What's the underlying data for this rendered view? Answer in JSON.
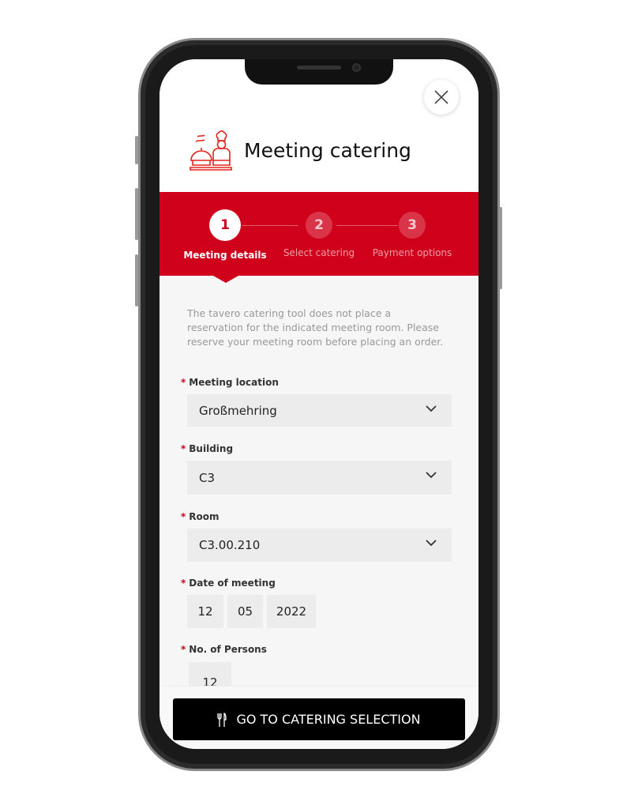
{
  "header": {
    "title": "Meeting catering",
    "logo_icon": "chef-catering-icon",
    "close_icon": "close-icon"
  },
  "stepper": {
    "steps": [
      {
        "number": "1",
        "label": "Meeting details",
        "active": true
      },
      {
        "number": "2",
        "label": "Select catering",
        "active": false
      },
      {
        "number": "3",
        "label": "Payment options",
        "active": false
      }
    ]
  },
  "info_text": "The tavero catering tool does not place a reservation for the indicated meeting room. Please reserve your meeting room before placing an order.",
  "form": {
    "required_mark": "*",
    "location": {
      "label": "Meeting location",
      "value": "Großmehring"
    },
    "building": {
      "label": "Building",
      "value": "C3"
    },
    "room": {
      "label": "Room",
      "value": "C3.00.210"
    },
    "date": {
      "label": "Date of meeting",
      "day": "12",
      "month": "05",
      "year": "2022"
    },
    "persons": {
      "label": "No. of Persons",
      "value": "12"
    }
  },
  "footer": {
    "button_label": "GO TO CATERING SELECTION",
    "button_icon": "cutlery-icon"
  },
  "colors": {
    "accent": "#d0021b",
    "button": "#000000"
  }
}
